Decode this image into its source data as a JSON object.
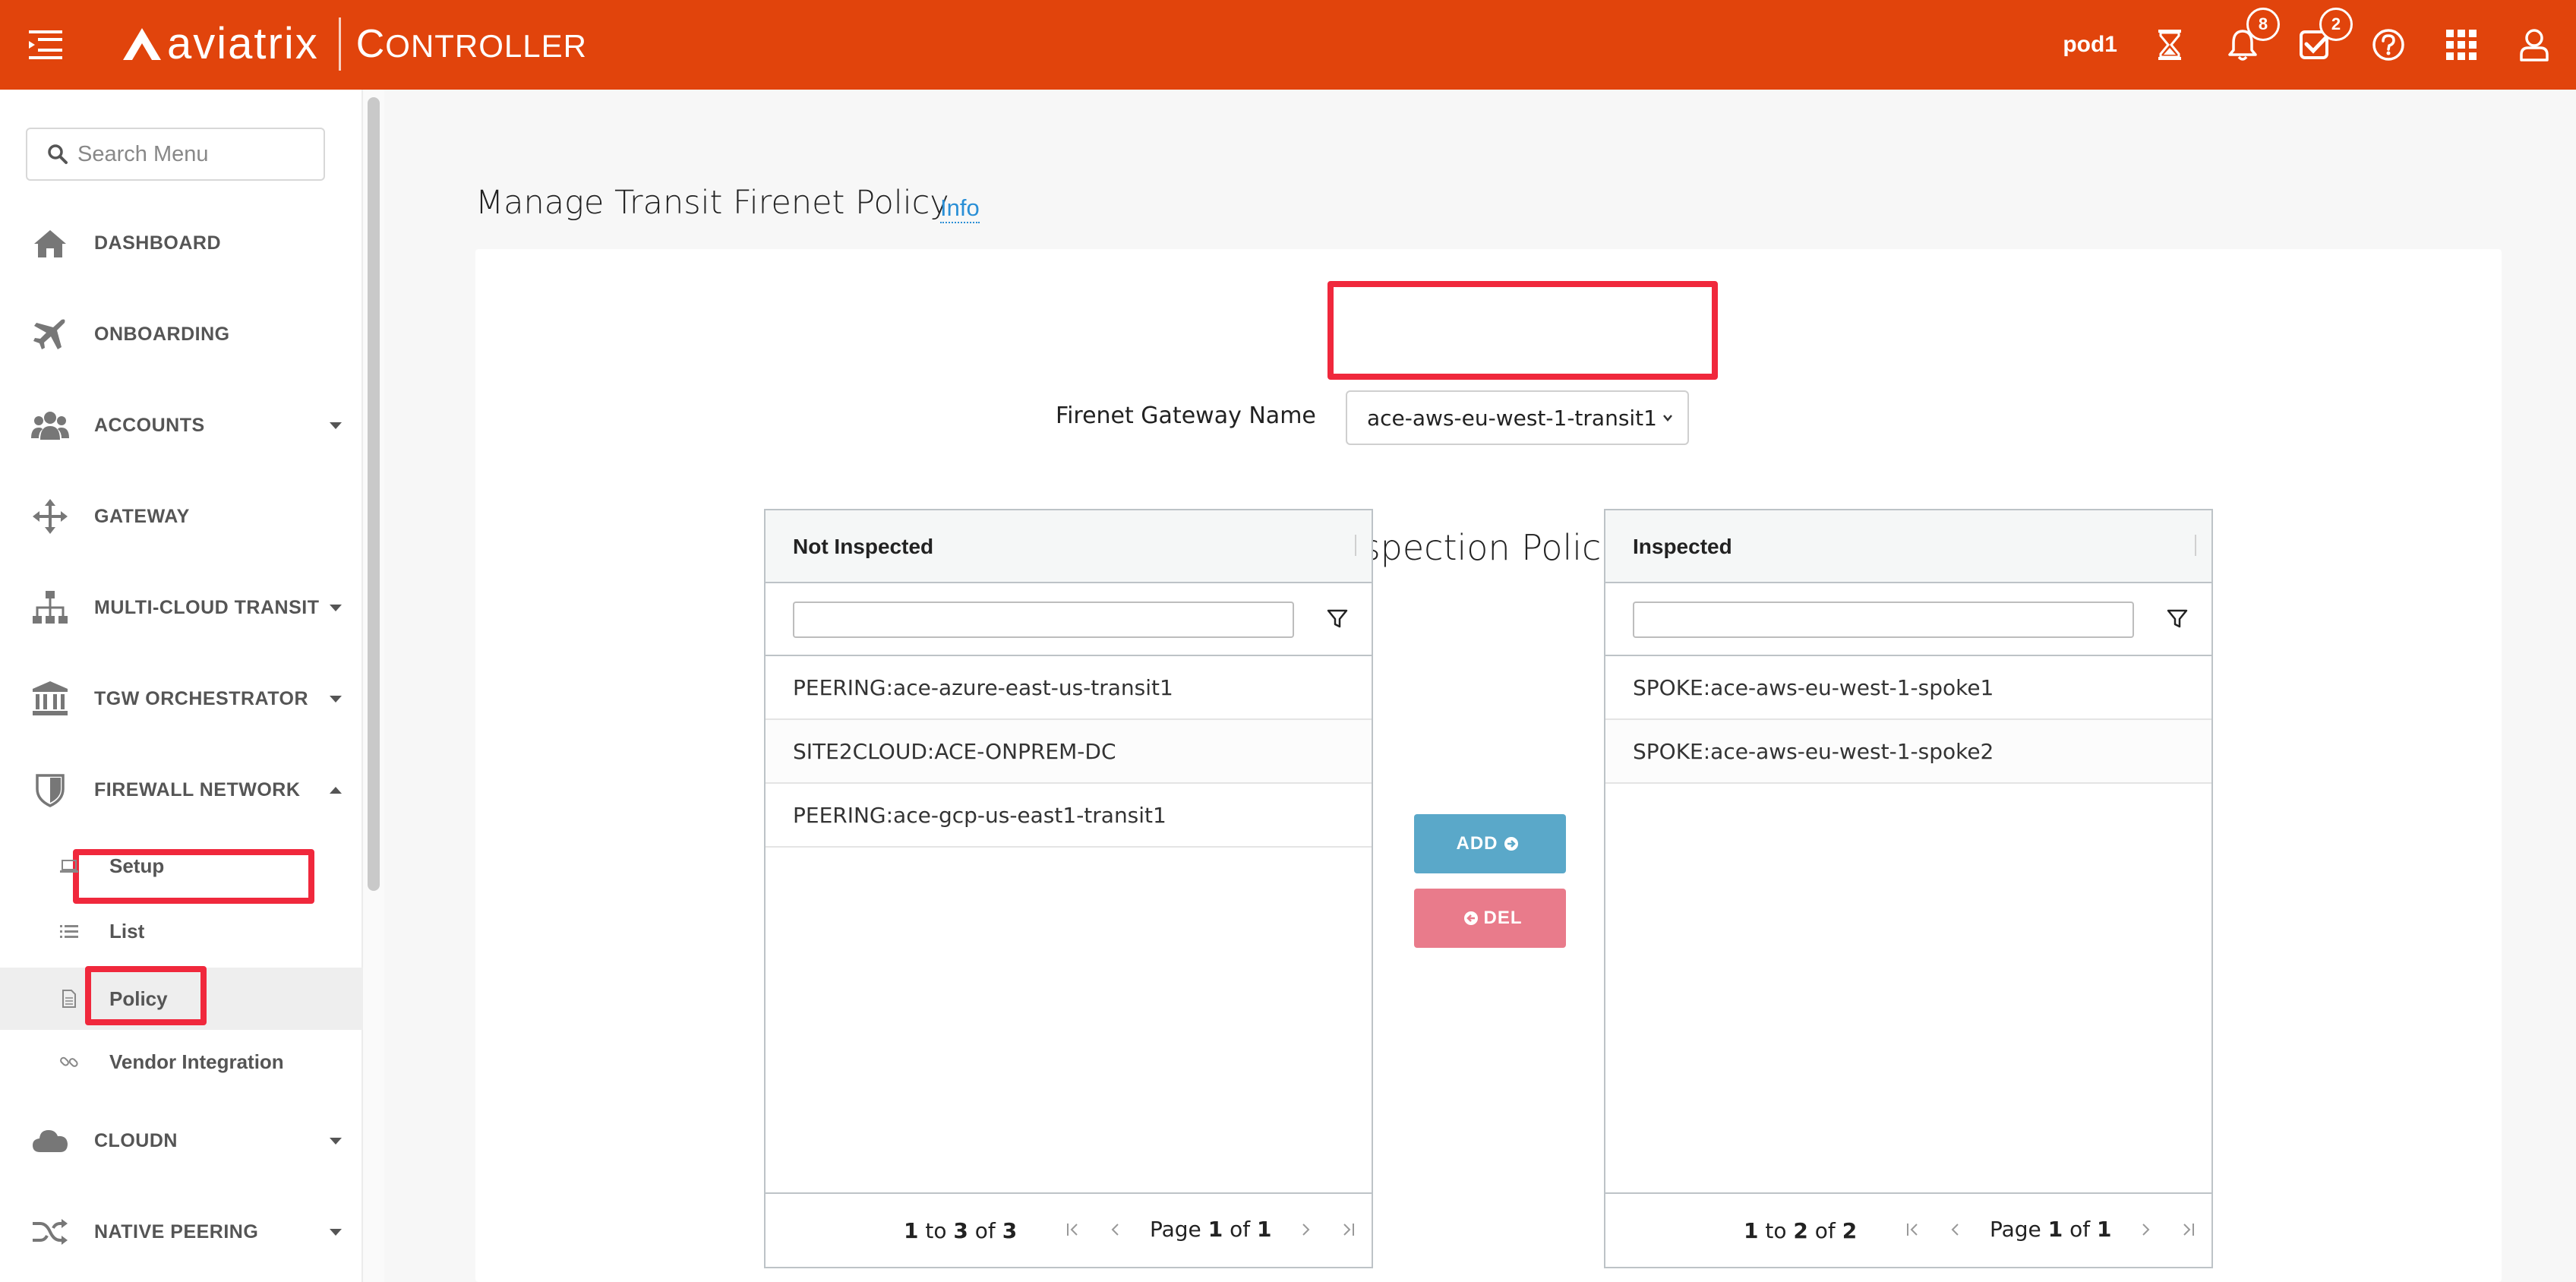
{
  "header": {
    "brand": "aviatrix",
    "product": "Controller",
    "product_first": "C",
    "product_rest": "ONTROLLER",
    "pod": "pod1",
    "notifications_count": "8",
    "tasks_count": "2",
    "accent_color": "#e1440c"
  },
  "sidebar": {
    "search_placeholder": "Search Menu",
    "items": [
      {
        "label": "DASHBOARD",
        "icon": "home-icon"
      },
      {
        "label": "ONBOARDING",
        "icon": "plane-icon"
      },
      {
        "label": "ACCOUNTS",
        "icon": "users-icon"
      },
      {
        "label": "GATEWAY",
        "icon": "arrows-icon"
      },
      {
        "label": "MULTI-CLOUD TRANSIT",
        "icon": "sitemap-icon"
      },
      {
        "label": "TGW ORCHESTRATOR",
        "icon": "bank-icon"
      },
      {
        "label": "FIREWALL NETWORK",
        "icon": "shield-icon"
      },
      {
        "label": "CLOUDN",
        "icon": "cloud-icon"
      },
      {
        "label": "NATIVE PEERING",
        "icon": "shuffle-icon"
      }
    ],
    "subitems": [
      {
        "label": "Setup",
        "icon": "laptop-icon"
      },
      {
        "label": "List",
        "icon": "list-icon"
      },
      {
        "label": "Policy",
        "icon": "document-icon"
      },
      {
        "label": "Vendor Integration",
        "icon": "link-icon"
      }
    ]
  },
  "main": {
    "title": "Manage Transit Firenet Policy",
    "info_link": "Info",
    "gateway_label": "Firenet Gateway Name",
    "gateway_value": "ace-aws-eu-west-1-transit1",
    "section_title": "Inspection Policies",
    "add_label": "ADD",
    "del_label": "DEL",
    "not_inspected": {
      "header": "Not Inspected",
      "rows": [
        "PEERING:ace-azure-east-us-transit1",
        "SITE2CLOUD:ACE-ONPREM-DC",
        "PEERING:ace-gcp-us-east1-transit1"
      ],
      "range_from": "1",
      "range_to": "3",
      "total": "3",
      "page": "1",
      "pages": "1"
    },
    "inspected": {
      "header": "Inspected",
      "rows": [
        "SPOKE:ace-aws-eu-west-1-spoke1",
        "SPOKE:ace-aws-eu-west-1-spoke2"
      ],
      "range_from": "1",
      "range_to": "2",
      "total": "2",
      "page": "1",
      "pages": "1"
    },
    "pager_words": {
      "to": "to",
      "of": "of",
      "page": "Page"
    }
  }
}
